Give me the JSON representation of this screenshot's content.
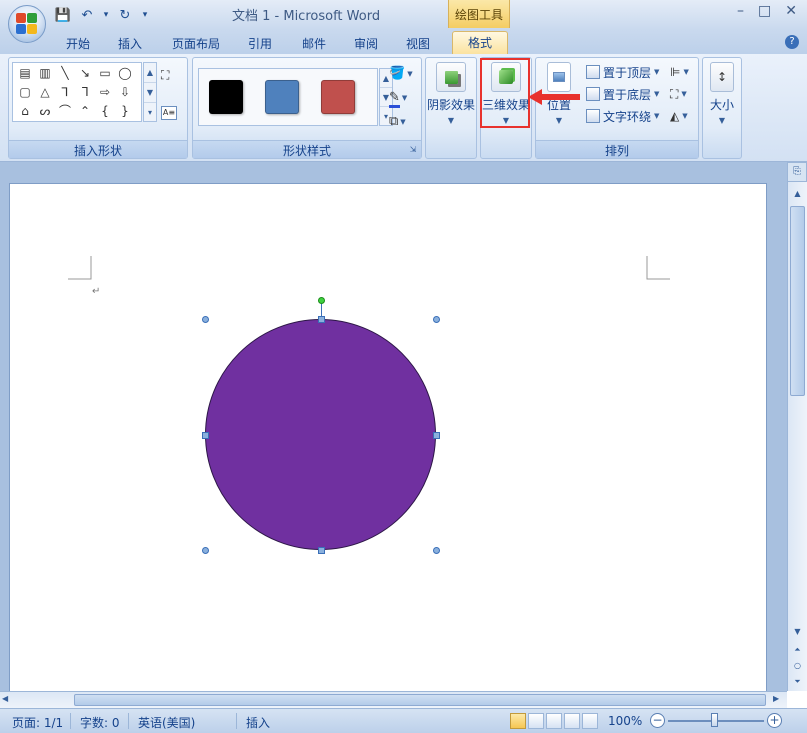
{
  "window": {
    "title": "文档 1 - Microsoft Word",
    "context_tab_title": "绘图工具",
    "minimize": "–",
    "restore": "□",
    "close": "✕"
  },
  "qat": {
    "save": "💾",
    "undo": "↶",
    "dropdown": "▾",
    "redo": "↻",
    "customize": "▾"
  },
  "tabs": [
    {
      "label": "开始"
    },
    {
      "label": "插入"
    },
    {
      "label": "页面布局"
    },
    {
      "label": "引用"
    },
    {
      "label": "邮件"
    },
    {
      "label": "审阅"
    },
    {
      "label": "视图"
    },
    {
      "label": "格式",
      "active": true
    }
  ],
  "help": "?",
  "ribbon": {
    "insert_shapes": {
      "label": "插入形状",
      "shapes": [
        "▤",
        "▥",
        "╲",
        "↘",
        "▭",
        "◯",
        "▢",
        "△",
        "⅂",
        "ᒣ",
        "⇨",
        "⇩",
        "⌂",
        "ᔕ",
        "⌒",
        "⌃",
        "{",
        "}"
      ]
    },
    "shape_styles": {
      "label": "形状样式",
      "swatch_colors": [
        "#000000",
        "#4f81bd",
        "#c0504d"
      ]
    },
    "shadow_effects": {
      "label": "阴影效果"
    },
    "three_d_effects": {
      "label": "三维效果"
    },
    "arrange": {
      "label": "排列",
      "position": "位置",
      "bring_to_front": "置于顶层",
      "send_to_back": "置于底层",
      "text_wrapping": "文字环绕"
    },
    "size": {
      "label": "大小"
    }
  },
  "shape_fill_color": "#7030a0",
  "statusbar": {
    "page": "页面: 1/1",
    "words": "字数: 0",
    "language": "英语(美国)",
    "mode": "插入",
    "zoom": "100%"
  }
}
